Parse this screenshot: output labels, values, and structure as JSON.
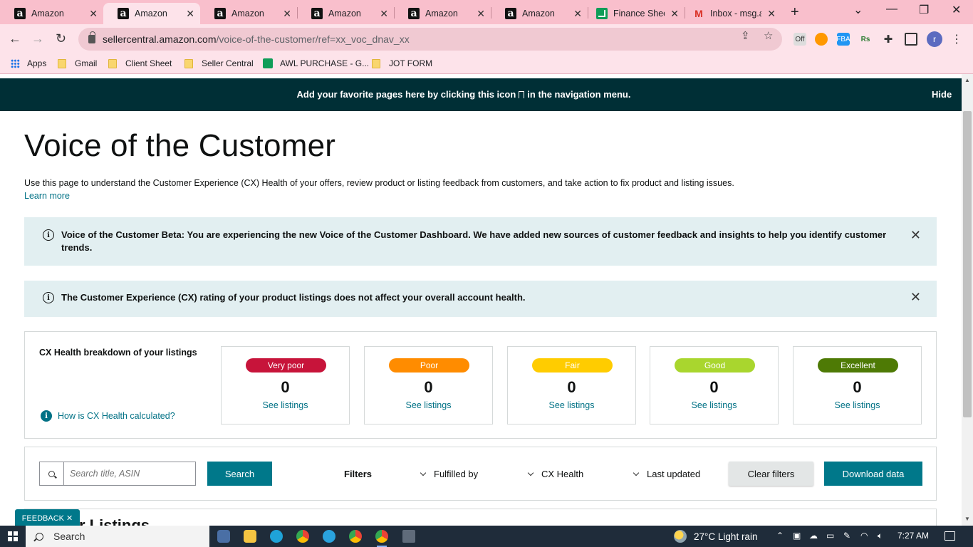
{
  "browser": {
    "tabs": [
      {
        "title": "Amazon",
        "icon": "amazon-icon"
      },
      {
        "title": "Amazon",
        "icon": "amazon-icon",
        "active": true
      },
      {
        "title": "Amazon",
        "icon": "amazon-icon"
      },
      {
        "title": "Amazon",
        "icon": "amazon-icon"
      },
      {
        "title": "Amazon",
        "icon": "amazon-icon"
      },
      {
        "title": "Amazon",
        "icon": "amazon-icon"
      },
      {
        "title": "Finance Shee",
        "icon": "google-sheets-icon"
      },
      {
        "title": "Inbox - msg.a",
        "icon": "gmail-icon"
      }
    ],
    "url_host": "sellercentral.amazon.com",
    "url_path": "/voice-of-the-customer/ref=xx_voc_dnav_xx",
    "avatar_letter": "r",
    "bookmarks": {
      "apps": "Apps",
      "gmail": "Gmail",
      "client_sheet": "Client Sheet",
      "seller_central": "Seller Central",
      "awl_purchase": "AWL PURCHASE - G...",
      "jot_form": "JOT FORM"
    }
  },
  "favorites_bar": {
    "message_before": "Add your favorite pages here by clicking this icon",
    "message_after": "in the navigation menu.",
    "hide": "Hide"
  },
  "page": {
    "title": "Voice of the Customer",
    "intro": "Use this page to understand the Customer Experience (CX) Health of your offers, review product or listing feedback from customers, and take action to fix product and listing issues.",
    "learn_more": "Learn more",
    "alerts": [
      {
        "text": "Voice of the Customer Beta: You are experiencing the new Voice of the Customer Dashboard. We have added new sources of customer feedback and insights to help you identify customer trends."
      },
      {
        "text": "The Customer Experience (CX) rating of your product listings does not affect your overall account health."
      }
    ],
    "cx_health": {
      "label": "CX Health breakdown of your listings",
      "how_link": "How is CX Health calculated?",
      "cards": [
        {
          "label": "Very poor",
          "count": "0",
          "link": "See listings",
          "color": "#c7143a",
          "text_color": "#ffffff"
        },
        {
          "label": "Poor",
          "count": "0",
          "link": "See listings",
          "color": "#ff8c00",
          "text_color": "#ffffff"
        },
        {
          "label": "Fair",
          "count": "0",
          "link": "See listings",
          "color": "#ffcc00",
          "text_color": "#ffffff"
        },
        {
          "label": "Good",
          "count": "0",
          "link": "See listings",
          "color": "#a9d62e",
          "text_color": "#ffffff"
        },
        {
          "label": "Excellent",
          "count": "0",
          "link": "See listings",
          "color": "#4e7a05",
          "text_color": "#ffffff"
        }
      ]
    },
    "filters": {
      "search_placeholder": "Search title, ASIN",
      "search_button": "Search",
      "filters_label": "Filters",
      "fulfilled_by": "Fulfilled by",
      "cx_health": "CX Health",
      "last_updated": "Last updated",
      "clear_filters": "Clear filters",
      "download": "Download data"
    },
    "listings_heading": "r Listings",
    "feedback": "FEEDBACK ✕"
  },
  "taskbar": {
    "search": "Search",
    "weather": "27°C  Light rain",
    "time": "7:27 AM"
  },
  "colors": {
    "accent": "#00788a",
    "link": "#007185",
    "header_bar": "#002f36",
    "alert_bg": "#e2eff1"
  }
}
